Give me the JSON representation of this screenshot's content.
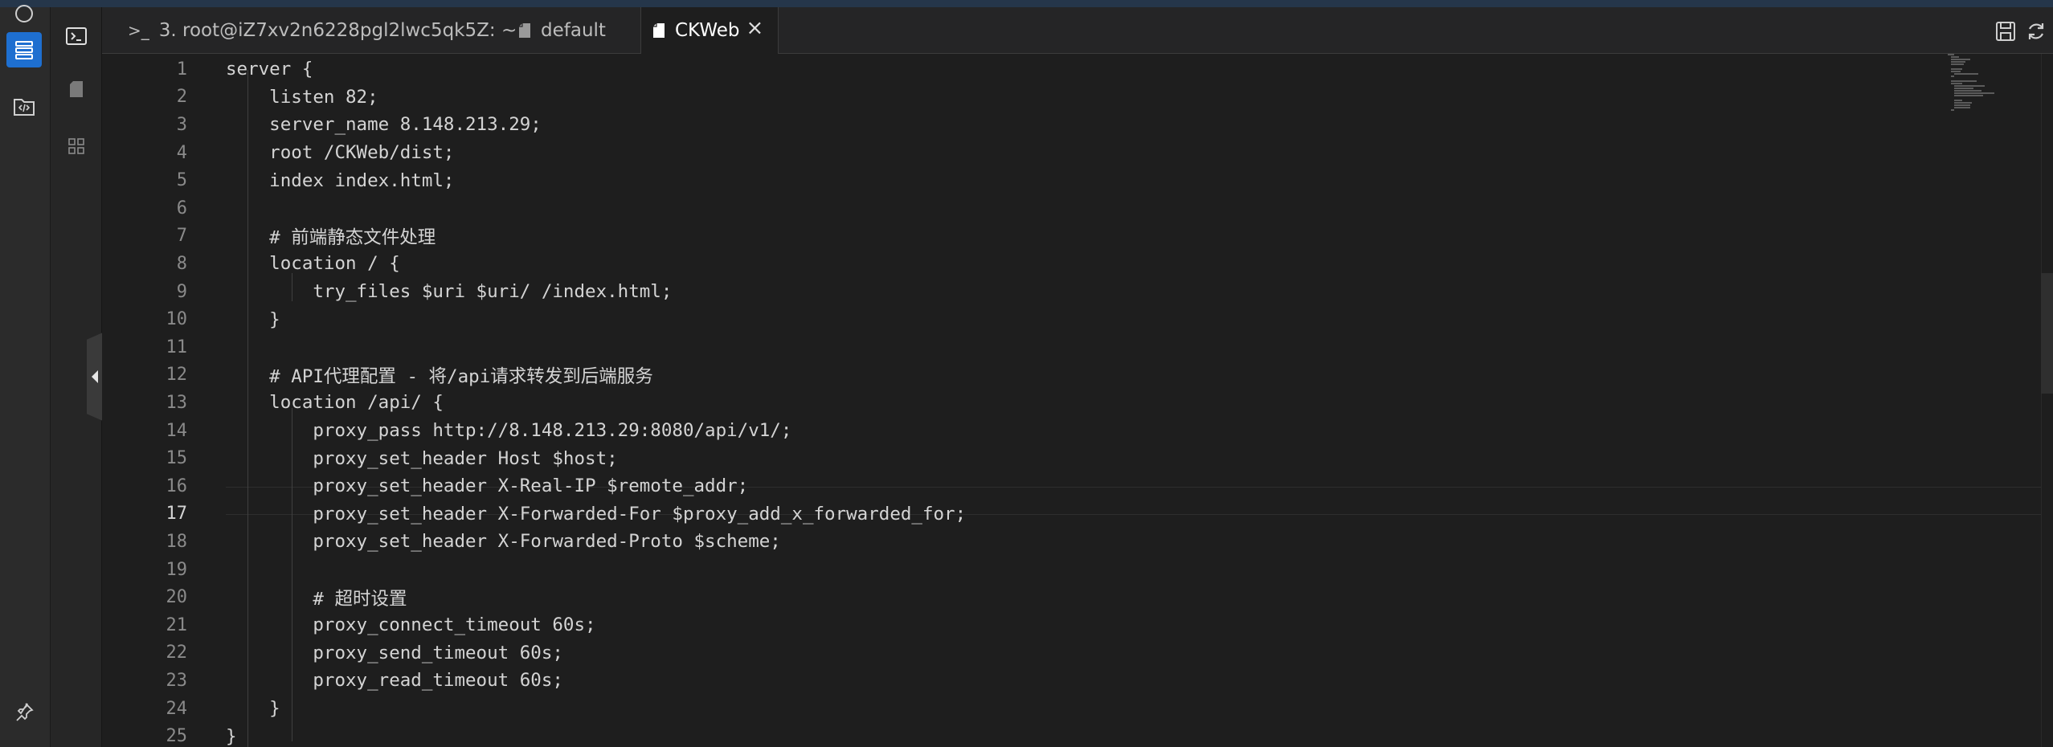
{
  "tabs": [
    {
      "label": "3. root@iZ7xv2n6228pgl2lwc5qk5Z: ~",
      "icon": "terminal-prompt-icon"
    },
    {
      "label": "default",
      "icon": "file-icon"
    },
    {
      "label": "CKWeb",
      "icon": "file-icon",
      "active": true,
      "close": "×"
    }
  ],
  "terminal_prompt_glyph": ">_",
  "editor": {
    "active_line": 17,
    "lines": [
      {
        "n": "1",
        "text": "server {"
      },
      {
        "n": "2",
        "text": "    listen 82;"
      },
      {
        "n": "3",
        "text": "    server_name 8.148.213.29;"
      },
      {
        "n": "4",
        "text": "    root /CKWeb/dist;"
      },
      {
        "n": "5",
        "text": "    index index.html;"
      },
      {
        "n": "6",
        "text": ""
      },
      {
        "n": "7",
        "text": "    # 前端静态文件处理"
      },
      {
        "n": "8",
        "text": "    location / {"
      },
      {
        "n": "9",
        "text": "        try_files $uri $uri/ /index.html;"
      },
      {
        "n": "10",
        "text": "    }"
      },
      {
        "n": "11",
        "text": ""
      },
      {
        "n": "12",
        "text": "    # API代理配置 - 将/api请求转发到后端服务"
      },
      {
        "n": "13",
        "text": "    location /api/ {"
      },
      {
        "n": "14",
        "text": "        proxy_pass http://8.148.213.29:8080/api/v1/;"
      },
      {
        "n": "15",
        "text": "        proxy_set_header Host $host;"
      },
      {
        "n": "16",
        "text": "        proxy_set_header X-Real-IP $remote_addr;"
      },
      {
        "n": "17",
        "text": "        proxy_set_header X-Forwarded-For $proxy_add_x_forwarded_for;"
      },
      {
        "n": "18",
        "text": "        proxy_set_header X-Forwarded-Proto $scheme;"
      },
      {
        "n": "19",
        "text": ""
      },
      {
        "n": "20",
        "text": "        # 超时设置"
      },
      {
        "n": "21",
        "text": "        proxy_connect_timeout 60s;"
      },
      {
        "n": "22",
        "text": "        proxy_send_timeout 60s;"
      },
      {
        "n": "23",
        "text": "        proxy_read_timeout 60s;"
      },
      {
        "n": "24",
        "text": "    }"
      },
      {
        "n": "25",
        "text": "}"
      }
    ]
  },
  "activity_bar": {
    "items": [
      "terminal-icon",
      "server-list-icon",
      "code-folder-icon"
    ],
    "bottom": "pin-icon"
  },
  "tool_strip": {
    "items": [
      "file-icon",
      "grid-icon"
    ]
  },
  "colors": {
    "accent": "#1e6fd0",
    "editor_bg": "#1e1e1e",
    "text": "#d4d4d4",
    "line_number": "#8a8a8a"
  }
}
